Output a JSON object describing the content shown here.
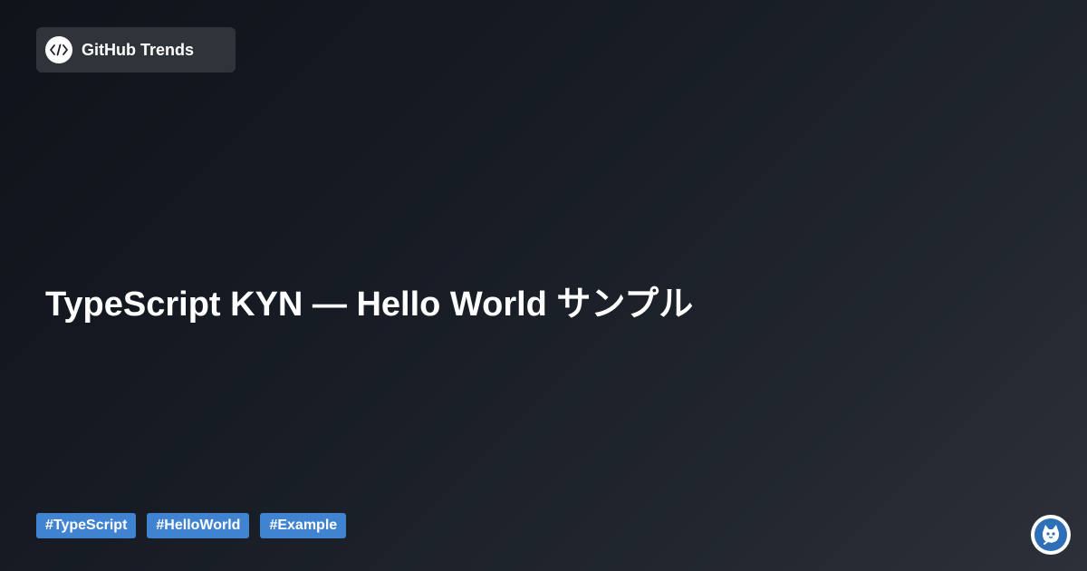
{
  "brand": {
    "name": "GitHub Trends",
    "logo_icon": "code-brackets-icon"
  },
  "title": "TypeScript KYN — Hello World サンプル",
  "tags": [
    {
      "label": "#TypeScript"
    },
    {
      "label": "#HelloWorld"
    },
    {
      "label": "#Example"
    }
  ],
  "mascot": {
    "icon": "cat-mascot-icon"
  },
  "colors": {
    "background_start": "#0f131a",
    "background_end": "#2c3038",
    "brand_chip": "#2f333a",
    "tag": "#3f83d1",
    "mascot": "#2f6fb8",
    "text": "#ffffff"
  }
}
